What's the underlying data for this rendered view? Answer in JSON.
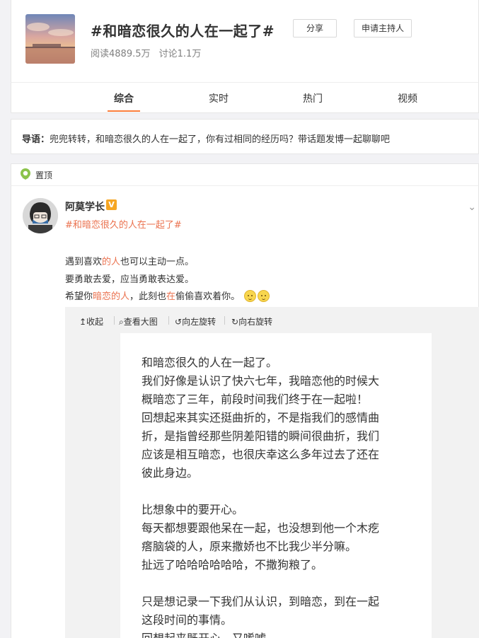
{
  "header": {
    "title": "#和暗恋很久的人在一起了#",
    "reads": "阅读4889.5万",
    "discussions": "讨论1.1万",
    "share_label": "分享",
    "host_label": "申请主持人"
  },
  "tabs": [
    "综合",
    "实时",
    "热门",
    "视频"
  ],
  "guide": {
    "label": "导语：",
    "text": "兜兜转转，和暗恋很久的人在一起了，你有过相同的经历吗？带话题发博一起聊聊吧"
  },
  "pinned_label": "置顶",
  "post": {
    "username": "阿莫学长",
    "vip_badge": "V",
    "topic_link": "#和暗恋很久的人在一起了#",
    "lines": {
      "l1_a": "遇到喜欢",
      "l1_hl": "的人",
      "l1_b": "也可以主动一点。",
      "l2": "要勇敢去爱，应当勇敢表达爱。",
      "l3_a": "希望你",
      "l3_hl1": "暗恋的人",
      "l3_b": "，此刻也",
      "l3_hl2": "在",
      "l3_c": "偷偷喜欢着你。"
    }
  },
  "media_toolbar": {
    "collapse": "↥收起",
    "view_large": "查看大图",
    "rotate_left": "向左旋转",
    "rotate_right": "向右旋转"
  },
  "image_text": [
    "和暗恋很久的人在一起了。",
    "我们好像是认识了快六七年，我暗恋他的时候大",
    "概暗恋了三年，前段时间我们终于在一起啦！",
    "回想起来其实还挺曲折的，不是指我们的感情曲",
    "折，是指曾经那些阴差阳错的瞬间很曲折，我们",
    "应该是相互暗恋，也很庆幸这么多年过去了还在",
    "彼此身边。",
    "",
    "比想象中的要开心。",
    "每天都想要跟他呆在一起，也没想到他一个木疙",
    "瘩脑袋的人，原来撒娇也不比我少半分嘛。",
    "扯远了哈哈哈哈哈哈，不撒狗粮了。",
    "",
    "只是想记录一下我们从认识，到暗恋，到在一起",
    "这段时间的事情。",
    "回想起来既开心，又唏嘘。"
  ],
  "colors": {
    "accent": "#fa7d3c",
    "link": "#eb7350",
    "page_bg": "#f2f2f5"
  }
}
